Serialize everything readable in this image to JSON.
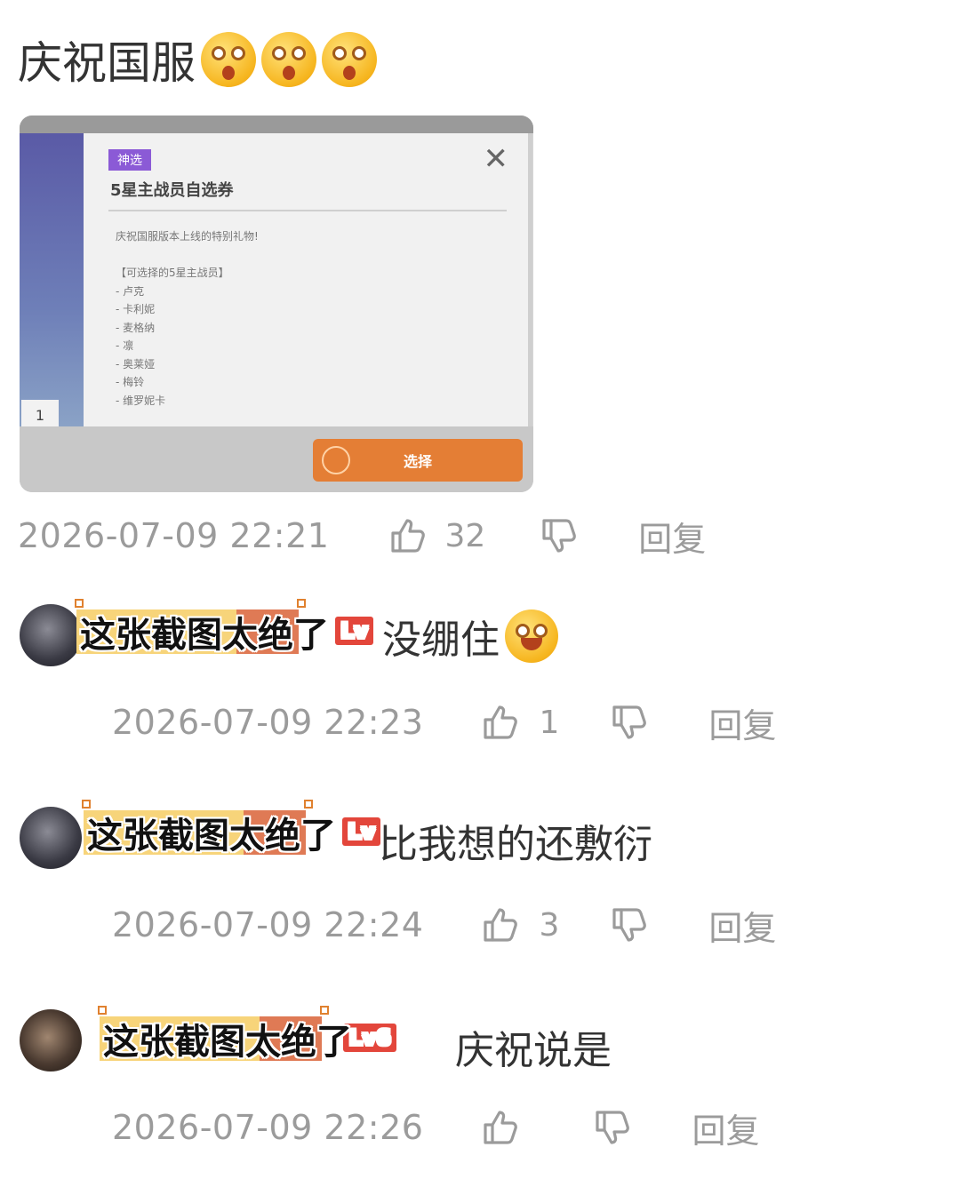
{
  "post": {
    "text": "庆祝国服",
    "emoji_count": 3,
    "emoji_icon": "shocked-face-emoji",
    "screenshot": {
      "tag": "神选",
      "title": "5星主战员自选券",
      "body_lines": [
        "庆祝国服版本上线的特别礼物!",
        "",
        "【可选择的5星主战员】",
        "- 卢克",
        "- 卡利妮",
        "- 麦格纳",
        "- 凛",
        "- 奥莱娅",
        "- 梅铃",
        "- 维罗妮卡"
      ],
      "side_number": "1",
      "button_label": "选择"
    },
    "meta": {
      "timestamp": "2026-07-09 22:21",
      "likes": "32",
      "reply_label": "回复"
    }
  },
  "comments": [
    {
      "username": "这张截图太绝了",
      "level_tag": "Lv",
      "text": "没绷住",
      "emoji_icon": "laughing-crying-emoji",
      "timestamp": "2026-07-09 22:23",
      "likes": "1",
      "reply_label": "回复"
    },
    {
      "username": "这张截图太绝了",
      "level_tag": "Lv",
      "text": "比我想的还敷衍",
      "timestamp": "2026-07-09 22:24",
      "likes": "3",
      "reply_label": "回复"
    },
    {
      "username": "这张截图太绝了",
      "level_tag": "Lv6",
      "text": "庆祝说是",
      "timestamp": "2026-07-09 22:26",
      "likes": "",
      "reply_label": "回复"
    }
  ],
  "colors": {
    "meta_gray": "#9b9b9b",
    "badge_yellow": "#f7d47a",
    "badge_orange": "#df7a55",
    "level_red": "#e3463b",
    "button_orange": "#e47e35"
  }
}
